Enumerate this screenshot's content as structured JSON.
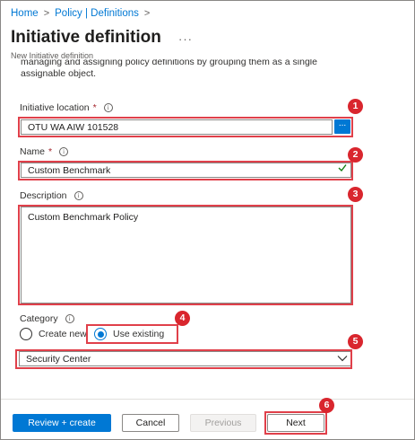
{
  "breadcrumb": {
    "home": "Home",
    "section": "Policy | Definitions",
    "sep": ">"
  },
  "page": {
    "title": "Initiative definition",
    "more": "···",
    "subtitle": "New Initiative definition",
    "desc_line1": "managing and assigning policy definitions by grouping them as a single",
    "desc_line2": "assignable object."
  },
  "location": {
    "label": "Initiative location",
    "required": "*",
    "value": "OTU WA AIW 101528",
    "browse": "..."
  },
  "name": {
    "label": "Name",
    "required": "*",
    "value": "Custom Benchmark"
  },
  "description": {
    "label": "Description",
    "value": "Custom Benchmark Policy"
  },
  "category": {
    "label": "Category",
    "options": [
      {
        "label": "Create new",
        "selected": false
      },
      {
        "label": "Use existing",
        "selected": true
      }
    ],
    "selected_value": "Security Center"
  },
  "footer": {
    "review": "Review + create",
    "cancel": "Cancel",
    "previous": "Previous",
    "next": "Next"
  },
  "callouts": [
    "1",
    "2",
    "3",
    "4",
    "5",
    "6"
  ],
  "icons": {
    "info": "i",
    "check": "check-icon",
    "chevron": "chevron-down-icon"
  },
  "colors": {
    "accent": "#0078d4",
    "callout": "#e0404a",
    "badge": "#d9262e",
    "success": "#107c10"
  }
}
